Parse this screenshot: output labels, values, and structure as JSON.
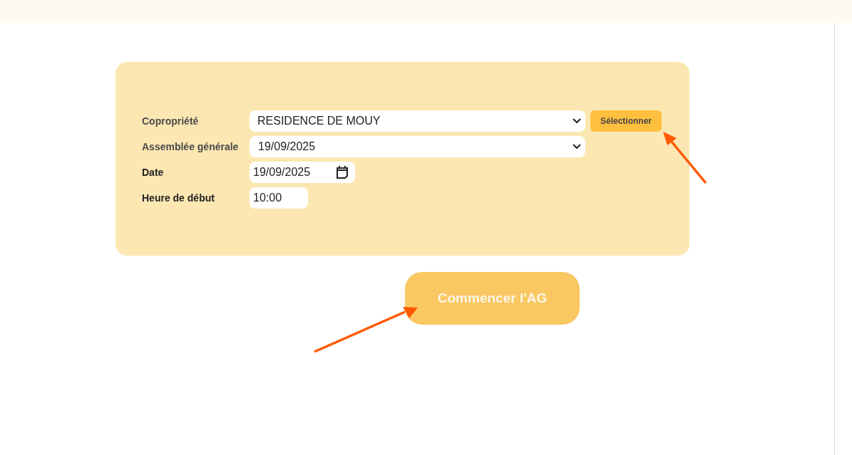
{
  "form": {
    "fields": [
      {
        "label": "Copropriété",
        "kind": "select",
        "value": "RESIDENCE DE MOUY",
        "action": "Sélectionner"
      },
      {
        "label": "Assemblée générale",
        "kind": "select",
        "value": "19/09/2025"
      },
      {
        "label": "Date",
        "kind": "date",
        "value": "19/09/2025"
      },
      {
        "label": "Heure de début",
        "kind": "time",
        "value": "10:00"
      }
    ]
  },
  "start_button": "Commencer l'AG"
}
